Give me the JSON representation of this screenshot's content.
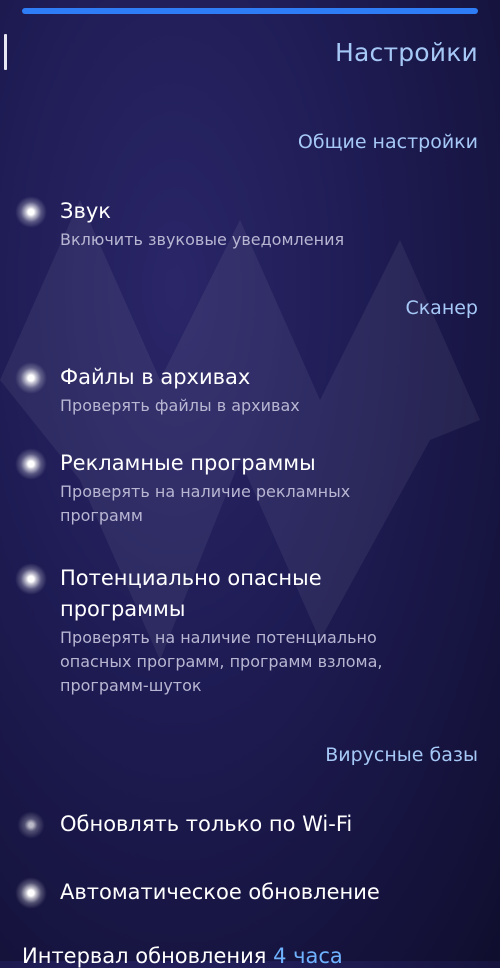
{
  "header": {
    "title": "Настройки"
  },
  "sections": {
    "general": "Общие настройки",
    "scanner": "Сканер",
    "virus_db": "Вирусные базы"
  },
  "items": {
    "sound": {
      "title": "Звук",
      "subtitle": "Включить звуковые уведомления",
      "enabled": true
    },
    "archives": {
      "title": "Файлы в архивах",
      "subtitle": "Проверять файлы в архивах",
      "enabled": true
    },
    "adware": {
      "title": "Рекламные программы",
      "subtitle": "Проверять на наличие рекламных программ",
      "enabled": true
    },
    "riskware": {
      "title": "Потенциально опасные программы",
      "subtitle": "Проверять на наличие потенциально опасных программ, программ взлома, программ-шуток",
      "enabled": true
    },
    "wifi_only": {
      "title": "Обновлять только по Wi-Fi",
      "enabled": false
    },
    "auto_update": {
      "title": "Автоматическое обновление",
      "enabled": true
    }
  },
  "update_interval": {
    "label": "Интервал обновления",
    "value": "4 часа"
  },
  "colors": {
    "accent": "#2f7df6",
    "section_text": "#a6c8f6",
    "link_value": "#6fb2ff"
  }
}
